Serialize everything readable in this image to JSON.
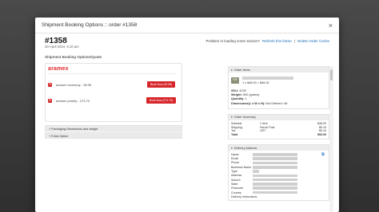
{
  "modal": {
    "title": "Shipment Booking Options :: order #1358",
    "close_glyph": "×"
  },
  "order": {
    "number": "#1358",
    "date": "30-April-2024, 6:10 am"
  },
  "help": {
    "text": "Problem in loading some section?",
    "refresh_link": "Refresh this frame",
    "separator": "|",
    "clear_cache_link": "Delete Order Cache"
  },
  "quotes": {
    "section_title": "Shipment Booking Options/Quote",
    "carrier_logo": "aramex",
    "rows": [
      {
        "label": "aramex economy - 38.95",
        "button": "Book Now (49.95)"
      },
      {
        "label": "aramex priority - 274.70",
        "button": "Book Now (274.70)"
      }
    ],
    "collapsibles": [
      "Packaging Dimensions and weight",
      "Extra Option"
    ]
  },
  "order_items": {
    "header": "Order Items",
    "price": "1 x $48.00 = $48.00",
    "details": [
      {
        "label": "SKU:",
        "value": "4233"
      },
      {
        "label": "Weight:",
        "value": "500 (grams)"
      },
      {
        "label": "Quantity:",
        "value": "1"
      },
      {
        "label": "Dimensions(L x W x H):",
        "value": "Not Defined / kit"
      }
    ]
  },
  "order_summary": {
    "header": "Order Summary",
    "rows": [
      {
        "label": "Subtotal",
        "mid": "1 item",
        "value": "$48.00"
      },
      {
        "label": "Shipping",
        "mid": "Parcel Post",
        "value": "$5.15"
      },
      {
        "label": "Tax",
        "mid": "GST",
        "value": "$5.15"
      },
      {
        "label": "Total",
        "mid": "",
        "value": "$53.00"
      }
    ]
  },
  "delivery": {
    "header": "Delivery Address",
    "fields": [
      "Name",
      "Email",
      "Phone",
      "Business Name",
      "Type",
      "Address",
      "Suburb",
      "State",
      "Postcode",
      "Country",
      "Delivery Instructions"
    ]
  },
  "colors": {
    "accent_red": "#d6262b",
    "link_blue": "#1a6fb8"
  }
}
